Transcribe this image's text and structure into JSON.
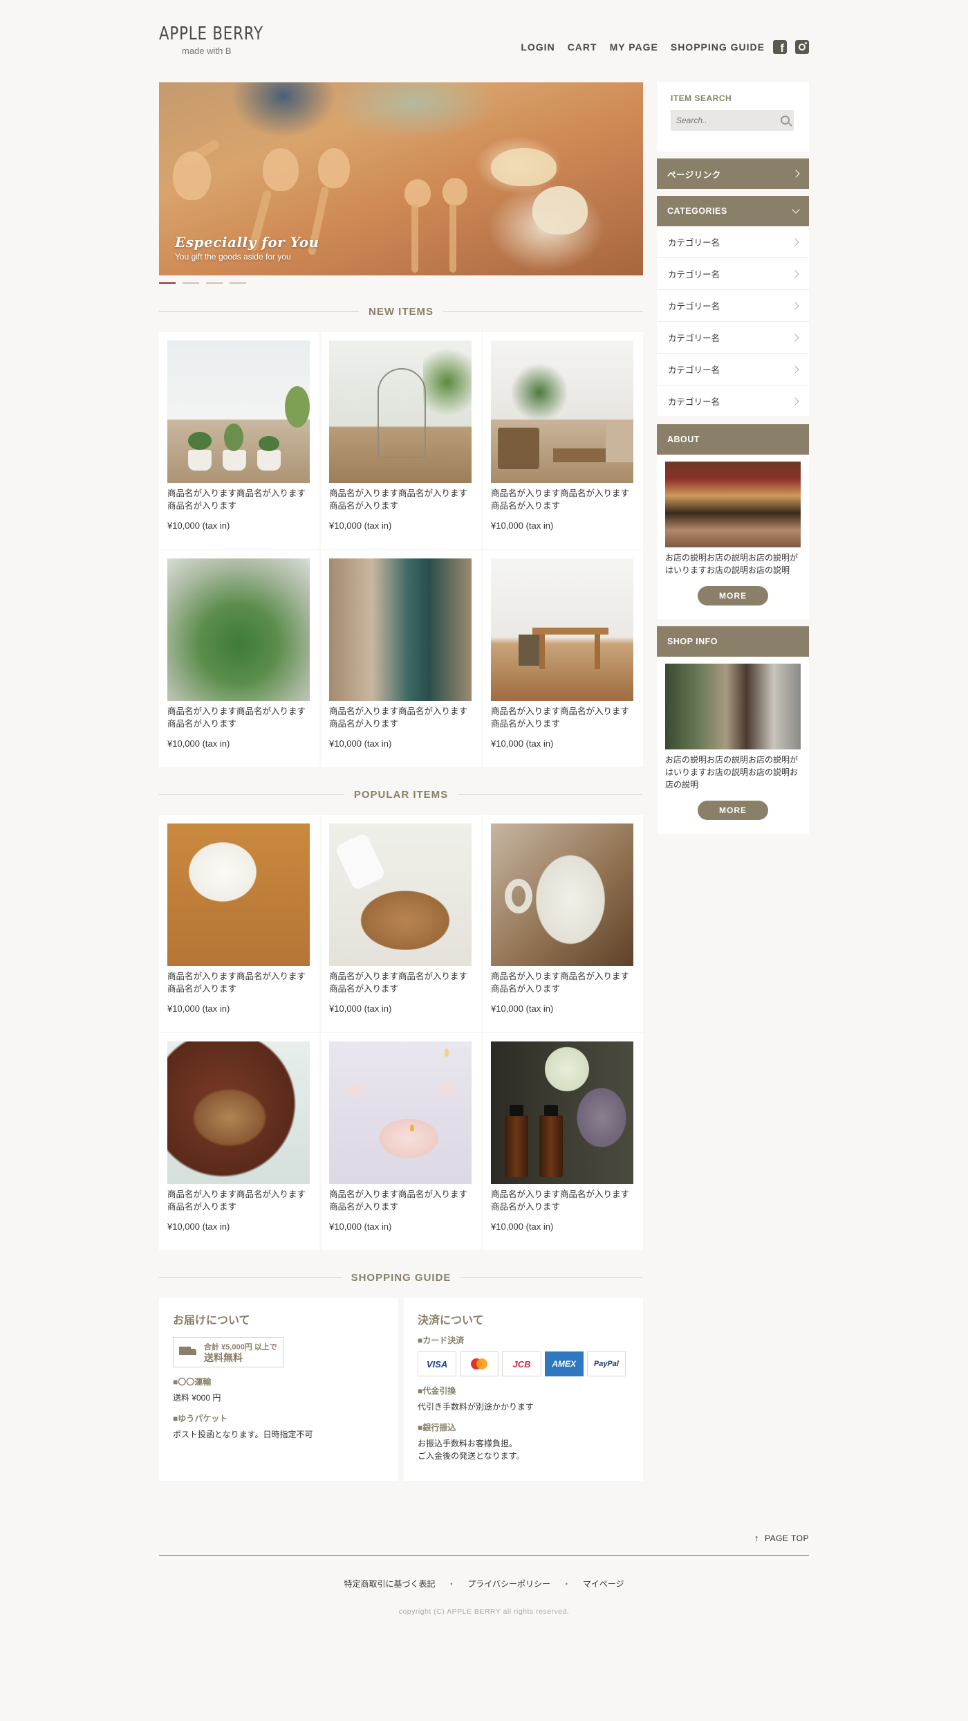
{
  "header": {
    "logo_title": "APPLE BERRY",
    "logo_sub": "made with B",
    "nav": [
      "LOGIN",
      "CART",
      "MY PAGE",
      "SHOPPING GUIDE"
    ],
    "social": [
      "facebook-icon",
      "instagram-icon"
    ]
  },
  "hero": {
    "title": "Especially for You",
    "subtitle": "You gift the goods aside for you",
    "slides": 4,
    "active_slide": 1
  },
  "sections": {
    "new_items": "NEW ITEMS",
    "popular_items": "POPULAR ITEMS",
    "shopping_guide": "SHOPPING GUIDE"
  },
  "new_items": [
    {
      "name": "商品名が入ります商品名が入ります商品名が入ります",
      "price": "¥10,000 (tax in)"
    },
    {
      "name": "商品名が入ります商品名が入ります商品名が入ります",
      "price": "¥10,000 (tax in)"
    },
    {
      "name": "商品名が入ります商品名が入ります商品名が入ります",
      "price": "¥10,000 (tax in)"
    },
    {
      "name": "商品名が入ります商品名が入ります商品名が入ります",
      "price": "¥10,000 (tax in)"
    },
    {
      "name": "商品名が入ります商品名が入ります商品名が入ります",
      "price": "¥10,000 (tax in)"
    },
    {
      "name": "商品名が入ります商品名が入ります商品名が入ります",
      "price": "¥10,000 (tax in)"
    }
  ],
  "popular_items": [
    {
      "name": "商品名が入ります商品名が入ります商品名が入ります",
      "price": "¥10,000 (tax in)"
    },
    {
      "name": "商品名が入ります商品名が入ります商品名が入ります",
      "price": "¥10,000 (tax in)"
    },
    {
      "name": "商品名が入ります商品名が入ります商品名が入ります",
      "price": "¥10,000 (tax in)"
    },
    {
      "name": "商品名が入ります商品名が入ります商品名が入ります",
      "price": "¥10,000 (tax in)"
    },
    {
      "name": "商品名が入ります商品名が入ります商品名が入ります",
      "price": "¥10,000 (tax in)"
    },
    {
      "name": "商品名が入ります商品名が入ります商品名が入ります",
      "price": "¥10,000 (tax in)"
    }
  ],
  "guide": {
    "delivery_title": "お届けについて",
    "free_small": "合計 ¥5,000円 以上で",
    "free_big": "送料無料",
    "shipping1_label": "■〇〇運輸",
    "shipping1_text": "送料 ¥000 円",
    "shipping2_label": "■ゆうパケット",
    "shipping2_text": "ポスト投函となります。日時指定不可",
    "payment_title": "決済について",
    "card_label": "■カード決済",
    "cards": [
      "VISA",
      "MasterCard",
      "JCB",
      "AMEX",
      "PayPal"
    ],
    "cod_label": "■代金引換",
    "cod_text": "代引き手数料が別途かかります",
    "bank_label": "■銀行振込",
    "bank_text1": "お振込手数料お客様負担。",
    "bank_text2": "ご入金後の発送となります。"
  },
  "sidebar": {
    "search_label": "ITEM SEARCH",
    "search_placeholder": "Search..",
    "page_link": "ページリンク",
    "categories_label": "CATEGORIES",
    "categories": [
      "カテゴリー名",
      "カテゴリー名",
      "カテゴリー名",
      "カテゴリー名",
      "カテゴリー名",
      "カテゴリー名"
    ],
    "about_label": "ABOUT",
    "about_text": "お店の説明お店の説明お店の説明がはいりますお店の説明お店の説明",
    "shop_info_label": "SHOP INFO",
    "shop_info_text": "お店の説明お店の説明お店の説明がはいりますお店の説明お店の説明お店の説明",
    "more_label": "MORE"
  },
  "footer": {
    "page_top": "PAGE TOP",
    "links": [
      "特定商取引に基づく表記",
      "プライバシーポリシー",
      "マイページ"
    ],
    "separator": "・",
    "copyright": "copyright (C) APPLE BERRY all rights reserved."
  },
  "colors": {
    "accent": "#8a7f68",
    "background": "#f8f7f5",
    "slider_active": "#8c2f3a",
    "amex_blue": "#2e78bf"
  }
}
